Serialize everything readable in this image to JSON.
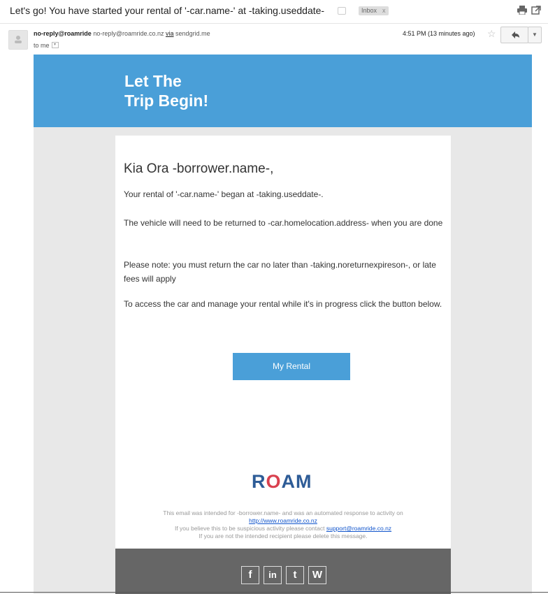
{
  "email": {
    "subject": "Let's go! You have started your rental of '-car.name-' at -taking.useddate-",
    "label_chip": "Inbox",
    "label_chip_close": "x",
    "sender_name": "no-reply@roamride",
    "sender_address": "no-reply@roamride.co.nz",
    "via_label": "via",
    "via_domain": "sendgrid.me",
    "recipient": "to me",
    "timestamp": "4:51 PM (13 minutes ago)"
  },
  "content": {
    "banner_line1": "Let The",
    "banner_line2": "Trip Begin!",
    "greeting": "Kia Ora -borrower.name-,",
    "para1": "Your rental of '-car.name-' began at -taking.useddate-.",
    "para2": "The vehicle will need to be returned to -car.homelocation.address- when you are done",
    "para3": "Please note: you must return the car no later than -taking.noreturnexpireson-, or late fees will apply",
    "para4": "To access the car and manage your rental while it's in progress click the button below.",
    "cta_label": "My Rental",
    "logo_text_r": "R",
    "logo_text_o": "O",
    "logo_text_am": "AM",
    "footer_line1": "This email was intended for -borrower.name- and was an automated response to activity on",
    "footer_link": "http://www.roamride.co.nz",
    "footer_line3_prefix": "If you believe this to be suspicious activity please contact",
    "footer_support": "support@roamride.co.nz",
    "footer_line4": "If you are not the intended recipient please delete this message."
  },
  "social": {
    "facebook": "f",
    "linkedin": "in",
    "twitter": "t",
    "wordpress": "W"
  },
  "colors": {
    "accent": "#4a9fd8",
    "logo_blue": "#2e5c97",
    "logo_red": "#d9414f",
    "footer_gray": "#666666"
  }
}
